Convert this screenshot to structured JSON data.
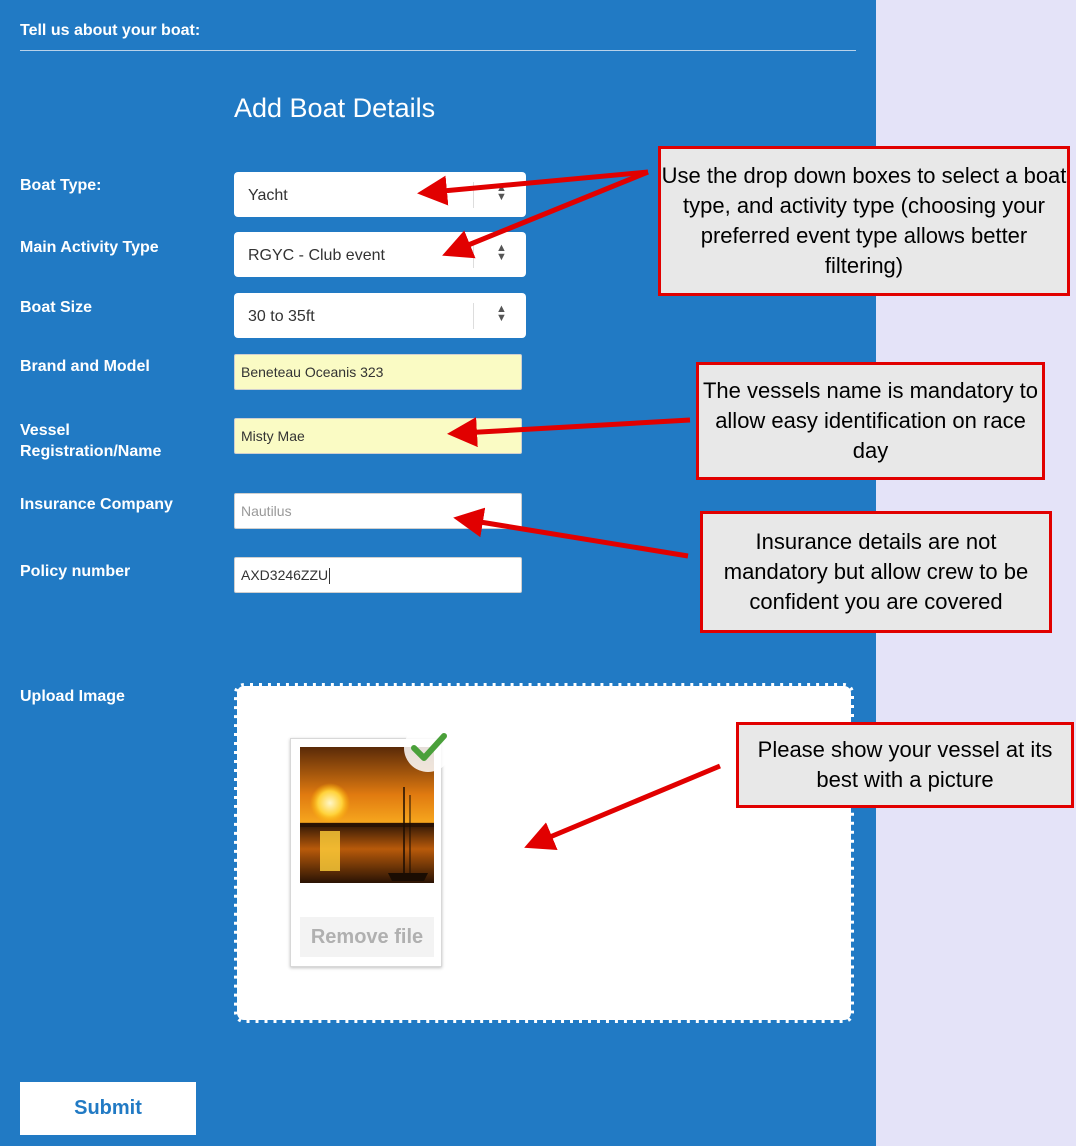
{
  "header": {
    "title": "Tell us about your boat:"
  },
  "form": {
    "title": "Add Boat Details",
    "boat_type": {
      "label": "Boat Type:",
      "value": "Yacht"
    },
    "activity_type": {
      "label": "Main Activity Type",
      "value": "RGYC - Club event"
    },
    "boat_size": {
      "label": "Boat Size",
      "value": "30 to 35ft"
    },
    "brand_model": {
      "label": "Brand and Model",
      "value": "Beneteau Oceanis 323"
    },
    "vessel_name": {
      "label_line1": "Vessel",
      "label_line2": "Registration/Name",
      "value": "Misty Mae"
    },
    "insurance": {
      "label": "Insurance Company",
      "placeholder": "Nautilus"
    },
    "policy": {
      "label": "Policy number",
      "value": "AXD3246ZZU"
    },
    "upload": {
      "label": "Upload Image",
      "remove_label": "Remove file"
    },
    "submit_label": "Submit"
  },
  "callouts": {
    "dropdowns": "Use the drop down boxes to select a boat type, and activity type (choosing your preferred event type allows better filtering)",
    "vessel_name": "The vessels name is mandatory to allow easy identification on race day",
    "insurance": "Insurance details are not mandatory but allow crew to be confident you are covered",
    "picture": "Please show your vessel at its best with a picture"
  },
  "colors": {
    "panel": "#217ac4",
    "page": "#e4e3f8",
    "callout_border": "#e10000",
    "arrow": "#e10000",
    "mandatory_field": "#fafbc4"
  }
}
